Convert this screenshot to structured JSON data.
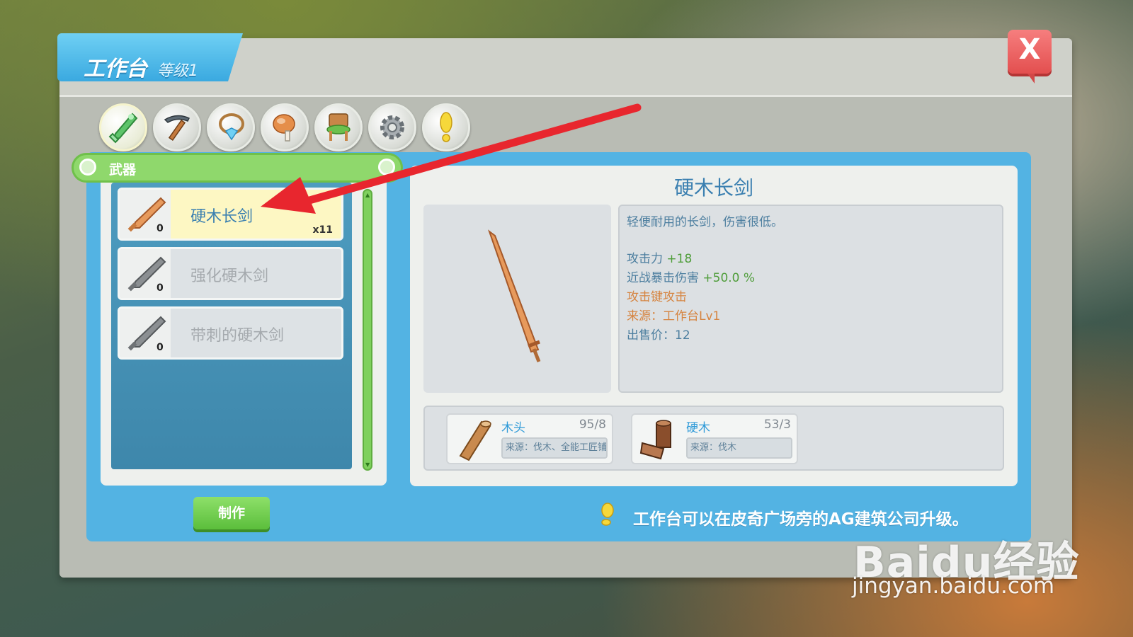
{
  "window": {
    "title": "工作台",
    "level": "等级1",
    "close_label": "X"
  },
  "categories": [
    {
      "name": "weapon",
      "icon": "green-sword-icon",
      "active": true
    },
    {
      "name": "tools",
      "icon": "pickaxe-icon",
      "active": false
    },
    {
      "name": "accessory",
      "icon": "pendant-icon",
      "active": false
    },
    {
      "name": "food",
      "icon": "meat-icon",
      "active": false
    },
    {
      "name": "furniture",
      "icon": "chair-icon",
      "active": false
    },
    {
      "name": "parts",
      "icon": "gear-icon",
      "active": false
    },
    {
      "name": "quest",
      "icon": "exclamation-icon",
      "active": false
    }
  ],
  "category_bar": {
    "label": "武器"
  },
  "recipes": [
    {
      "name": "硬木长剑",
      "count": "0",
      "qty": "x11",
      "selected": true
    },
    {
      "name": "强化硬木剑",
      "count": "0",
      "qty": "",
      "selected": false
    },
    {
      "name": "带刺的硬木剑",
      "count": "0",
      "qty": "",
      "selected": false
    }
  ],
  "craft_button": "制作",
  "detail": {
    "title": "硬木长剑",
    "description": "轻便耐用的长剑，伤害很低。",
    "attack_label": "攻击力",
    "attack_value": "+18",
    "crit_label": "近战暴击伤害",
    "crit_value": "+50.0 %",
    "attack_key": "攻击键攻击",
    "source": "来源：工作台Lv1",
    "price": "出售价：12"
  },
  "materials": [
    {
      "name": "木头",
      "count": "95/8",
      "source": "来源：伐木、全能工匠铺",
      "icon": "wood-log-icon"
    },
    {
      "name": "硬木",
      "count": "53/3",
      "source": "来源：伐木",
      "icon": "hardwood-icon"
    }
  ],
  "hint": "工作台可以在皮奇广场旁的AG建筑公司升级。",
  "watermark": {
    "brand": "Baidu经验",
    "url": "jingyan.baidu.com"
  },
  "colors": {
    "accent_blue": "#53b3e3",
    "accent_green": "#8fd86c",
    "close_red": "#e34f4f",
    "annotation_arrow": "#e8262e"
  }
}
